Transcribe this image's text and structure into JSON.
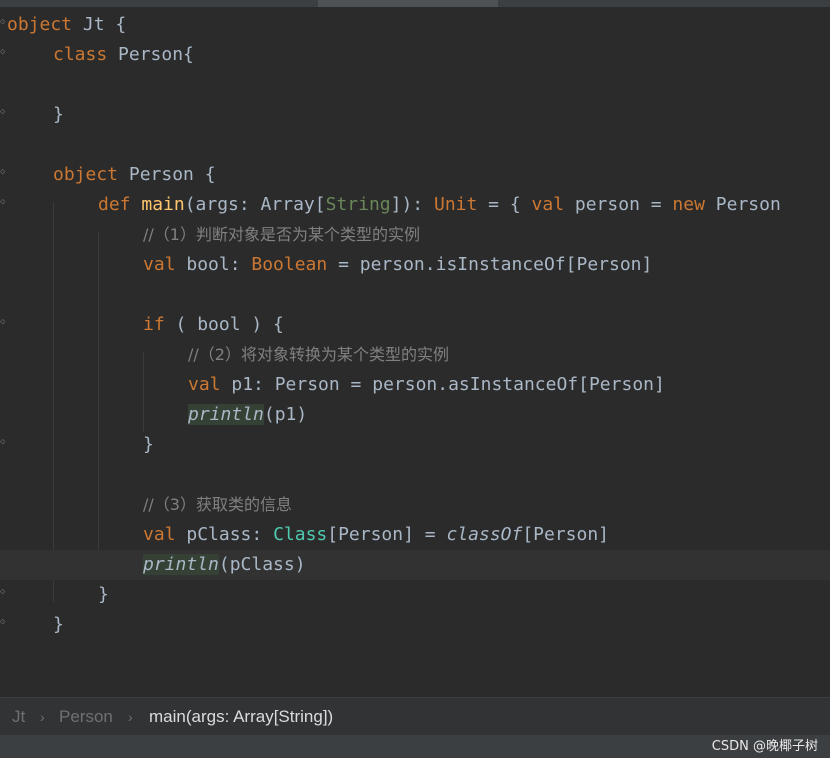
{
  "code": {
    "l1": {
      "kw": "object",
      "name": " Jt {"
    },
    "l2": {
      "kw": "class",
      "name": " Person{"
    },
    "l4": "}",
    "l6": {
      "kw": "object",
      "name": " Person {"
    },
    "l7": {
      "kw_def": "def",
      "fn": " main",
      "p1": "(args: Array[",
      "string_type": "String",
      "p2": "]): ",
      "unit": "Unit",
      "p3": " = { ",
      "kw_val": "val",
      "p4": " person = ",
      "kw_new": "new",
      "p5": " Person"
    },
    "l8_comment": "//（1）判断对象是否为某个类型的实例",
    "l9": {
      "kw_val": "val",
      "p1": " bool: ",
      "type": "Boolean",
      "p2": " = person.isInstanceOf[Person]"
    },
    "l11": {
      "kw_if": "if",
      "p1": " ( bool ) {"
    },
    "l12_comment": "//（2）将对象转换为某个类型的实例",
    "l13": {
      "kw_val": "val",
      "p1": " p1: Person = person.asInstanceOf[Person]"
    },
    "l14": {
      "fn": "println",
      "p1": "(p1)"
    },
    "l15": "}",
    "l17_comment": "//（3）获取类的信息",
    "l18": {
      "kw_val": "val",
      "p1": " pClass: ",
      "cls": "Class",
      "p2": "[Person] = ",
      "fn": "classOf",
      "p3": "[Person]"
    },
    "l19": {
      "fn": "println",
      "p1": "(pClass)"
    },
    "l20": "}",
    "l21": "}"
  },
  "breadcrumb": {
    "items": [
      "Jt",
      "Person",
      "main(args: Array[String])"
    ],
    "separator": "›"
  },
  "watermark": "CSDN @晚椰子树",
  "colors": {
    "background": "#2b2b2b",
    "keyword": "#cc7832",
    "function": "#ffc66d",
    "comment": "#808080",
    "text": "#a9b7c6",
    "type_teal": "#4ec9b0"
  }
}
